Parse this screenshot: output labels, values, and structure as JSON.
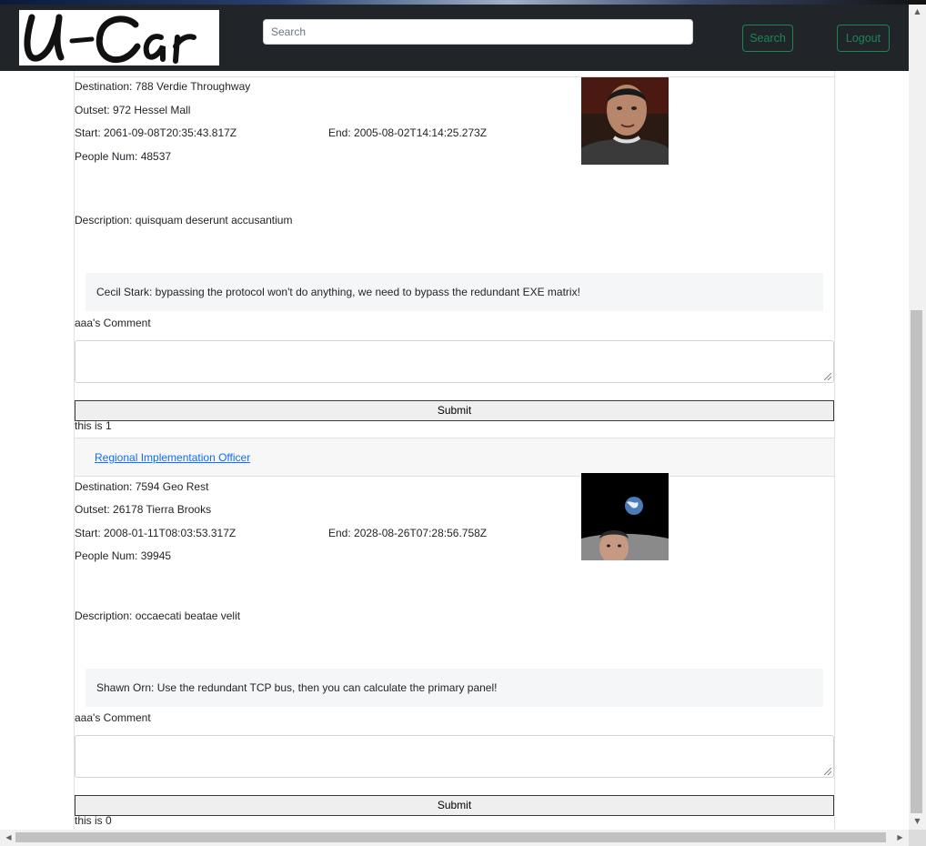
{
  "header": {
    "logo_text": "U-Car",
    "search_placeholder": "Search",
    "search_button": "Search",
    "logout_button": "Logout"
  },
  "trips": [
    {
      "destination": "Destination: 788 Verdie Throughway",
      "outset": "Outset: 972 Hessel Mall",
      "start": "Start: 2061-09-08T20:35:43.817Z",
      "end": "End: 2005-08-02T14:14:25.273Z",
      "people": "People Num: 48537",
      "description": "Description: quisquam deserunt accusantium",
      "comment": "Cecil Stark: bypassing the protocol won't do anything, we need to bypass the redundant EXE matrix!",
      "comment_label": "aaa's Comment",
      "submit": "Submit",
      "footer": "this is 1"
    },
    {
      "header_link": "Regional Implementation Officer",
      "destination": "Destination: 7594 Geo Rest",
      "outset": "Outset: 26178 Tierra Brooks",
      "start": "Start: 2008-01-11T08:03:53.317Z",
      "end": "End: 2028-08-26T07:28:56.758Z",
      "people": "People Num: 39945",
      "description": "Description: occaecati beatae velit",
      "comment": "Shawn Orn: Use the redundant TCP bus, then you can calculate the primary panel!",
      "comment_label": "aaa's Comment",
      "submit": "Submit",
      "footer": "this is 0"
    }
  ],
  "colors": {
    "navbar": "#212529",
    "accent_green": "#198754",
    "link_blue": "#0d6efd"
  }
}
